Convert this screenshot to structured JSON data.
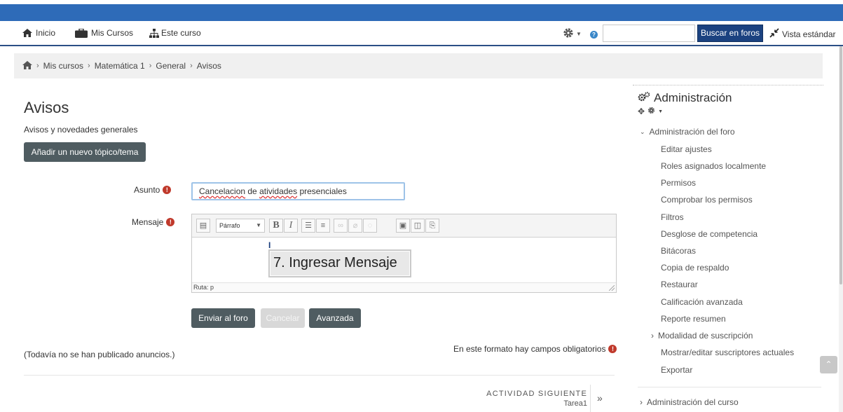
{
  "nav": {
    "home": "Inicio",
    "my_courses": "Mis Cursos",
    "this_course": "Este curso",
    "search_placeholder": "",
    "search_button": "Buscar en foros",
    "standard_view": "Vista estándar"
  },
  "breadcrumb": [
    "Mis cursos",
    "Matemática 1",
    "General",
    "Avisos"
  ],
  "main": {
    "title": "Avisos",
    "description": "Avisos y novedades generales",
    "add_topic": "Añadir un nuevo tópico/tema"
  },
  "form": {
    "subject_label": "Asunto",
    "subject_value_parts": [
      "Cancelacion",
      " de ",
      "atividades",
      " presenciales"
    ],
    "message_label": "Mensaje",
    "format_select": "Párrafo",
    "status_path": "Ruta: p",
    "tooltip": "7. Ingresar Mensaje",
    "submit": "Enviar al foro",
    "cancel": "Cancelar",
    "advanced": "Avanzada"
  },
  "footer": {
    "no_announcements": "(Todavía no se han publicado anuncios.)",
    "required_note": "En este formato hay campos obligatorios",
    "next_activity_label": "ACTIVIDAD SIGUIENTE",
    "next_activity_name": "Tarea1"
  },
  "admin": {
    "title": "Administración",
    "forum_admin": "Administración del foro",
    "links": [
      "Editar ajustes",
      "Roles asignados localmente",
      "Permisos",
      "Comprobar los permisos",
      "Filtros",
      "Desglose de competencia",
      "Bitácoras",
      "Copia de respaldo",
      "Restaurar",
      "Calificación avanzada",
      "Reporte resumen"
    ],
    "subscription_mode": "Modalidad de suscripción",
    "more_links": [
      "Mostrar/editar suscriptores actuales",
      "Exportar"
    ],
    "course_admin": "Administración del curso"
  },
  "colors": {
    "top_band": "#2e6bb8",
    "search_button": "#1b4280",
    "primary_button": "#4f5c61",
    "required": "#c0392b"
  }
}
